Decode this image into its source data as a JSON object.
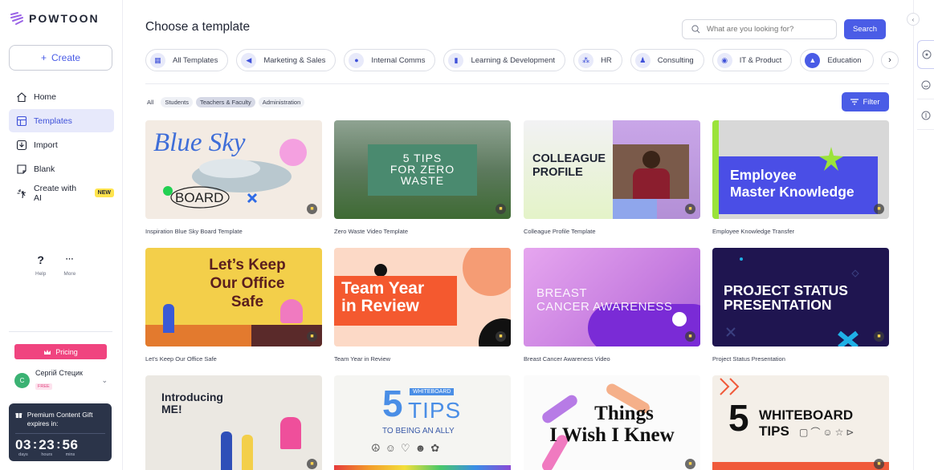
{
  "brand": {
    "name": "POWTOON"
  },
  "sidebar": {
    "create_label": "Create",
    "items": [
      {
        "label": "Home",
        "icon": "home-icon"
      },
      {
        "label": "Templates",
        "icon": "templates-icon",
        "active": true
      },
      {
        "label": "Import",
        "icon": "import-icon"
      },
      {
        "label": "Blank",
        "icon": "blank-icon"
      },
      {
        "label": "Create with AI",
        "icon": "sparkle-icon",
        "badge": "NEW"
      }
    ],
    "help_label": "Help",
    "more_label": "More",
    "pricing_label": "Pricing",
    "user": {
      "initial": "C",
      "name": "Сергій Стецик",
      "plan": "FREE"
    },
    "gift": {
      "title": "Premium Content Gift expires in:",
      "days": "03",
      "hours": "23",
      "mins": "56",
      "days_label": "days",
      "hours_label": "hours",
      "mins_label": "mins"
    }
  },
  "main": {
    "title": "Choose a template",
    "search_placeholder": "What are you looking for?",
    "search_button": "Search",
    "categories": [
      {
        "label": "All Templates",
        "icon": "grid-icon"
      },
      {
        "label": "Marketing & Sales",
        "icon": "megaphone-icon"
      },
      {
        "label": "Internal Comms",
        "icon": "chat-icon"
      },
      {
        "label": "Learning & Development",
        "icon": "book-icon"
      },
      {
        "label": "HR",
        "icon": "people-icon"
      },
      {
        "label": "Consulting",
        "icon": "consulting-icon"
      },
      {
        "label": "IT & Product",
        "icon": "chip-icon"
      },
      {
        "label": "Education",
        "icon": "graduation-cap-icon",
        "active": true
      }
    ],
    "subfilters": [
      "All",
      "Students",
      "Teachers & Faculty",
      "Administration"
    ],
    "active_subfilter": "Teachers & Faculty",
    "filter_button": "Filter",
    "templates": [
      {
        "title": "Inspiration Blue Sky Board Template",
        "thumb_text": [
          "Blue Sky",
          "BOARD"
        ]
      },
      {
        "title": "Zero Waste Video Template",
        "thumb_text": [
          "5 TIPS",
          "FOR ZERO",
          "WASTE"
        ]
      },
      {
        "title": "Colleague Profile Template",
        "thumb_text": [
          "COLLEAGUE",
          "PROFILE"
        ]
      },
      {
        "title": "Employee Knowledge Transfer",
        "thumb_text": [
          "Employee",
          "Master Knowledge"
        ]
      },
      {
        "title": "Let's Keep Our Office Safe",
        "thumb_text": [
          "Let’s Keep",
          "Our Office",
          "Safe"
        ]
      },
      {
        "title": "Team Year in Review",
        "thumb_text": [
          "Team Year",
          "in Review"
        ]
      },
      {
        "title": "Breast Cancer Awareness Video",
        "thumb_text": [
          "BREAST",
          "CANCER AWARENESS"
        ]
      },
      {
        "title": "Project Status Presentation",
        "thumb_text": [
          "PROJECT STATUS",
          "PRESENTATION"
        ]
      },
      {
        "title": "",
        "thumb_text": [
          "Introducing",
          "ME!"
        ]
      },
      {
        "title": "",
        "thumb_text": [
          "5",
          "WHITEBOARD",
          "TIPS",
          "TO BEING AN ALLY"
        ]
      },
      {
        "title": "",
        "thumb_text": [
          "Things",
          "I Wish I Knew"
        ]
      },
      {
        "title": "",
        "thumb_text": [
          "5",
          "WHITEBOARD",
          "TIPS"
        ]
      }
    ]
  },
  "colors": {
    "accent": "#4a5ce6",
    "pricing": "#f0447f",
    "new_badge": "#ffe44d"
  }
}
